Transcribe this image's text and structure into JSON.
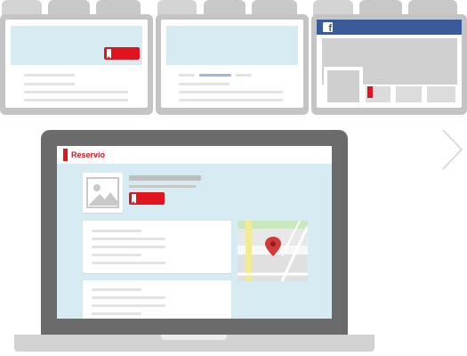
{
  "laptop_app": {
    "brand_name": "Reservio"
  },
  "social_window": {
    "brand_letter": "f"
  },
  "colors": {
    "accent": "#e0141e",
    "facebook_blue": "#3b5a99",
    "window_gray": "#c4c4c4",
    "screen_bg": "#d6ebf2",
    "map_green": "#c9e8bd",
    "map_yellow": "#f2eb96",
    "map_pin": "#d23a3a"
  },
  "icons": [
    "bookmark-icon",
    "facebook-icon",
    "image-placeholder-icon",
    "map-pin-icon",
    "chevron-right-icon"
  ]
}
